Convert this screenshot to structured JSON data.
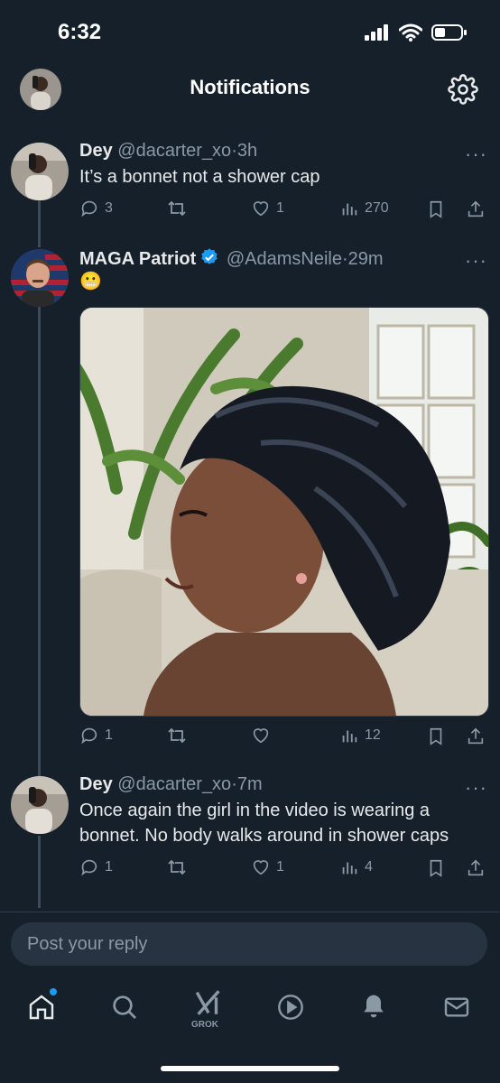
{
  "status_bar": {
    "time": "6:32"
  },
  "header": {
    "title": "Notifications"
  },
  "tweets": [
    {
      "name": "Dey",
      "handle": "@dacarter_xo",
      "time": "3h",
      "text": "It’s a bonnet not a shower cap",
      "replies": "3",
      "retweets": "",
      "likes": "1",
      "views": "270"
    },
    {
      "name": "MAGA Patriot",
      "handle": "@AdamsNeile",
      "time": "29m",
      "text": "😬",
      "verified": true,
      "replies": "1",
      "retweets": "",
      "likes": "",
      "views": "12"
    },
    {
      "name": "Dey",
      "handle": "@dacarter_xo",
      "time": "7m",
      "text_line1": "Once again the girl in the video is wearing a",
      "text_line2": "bonnet. No body walks around in shower caps",
      "replies": "1",
      "retweets": "",
      "likes": "1",
      "views": "4"
    }
  ],
  "reply": {
    "placeholder": "Post your reply"
  },
  "tabbar": {
    "grok_label": "GROK"
  },
  "colors": {
    "background": "#15202b",
    "accent": "#1d9bf0",
    "muted": "#8b98a5",
    "verified": "#1d9bf0"
  }
}
